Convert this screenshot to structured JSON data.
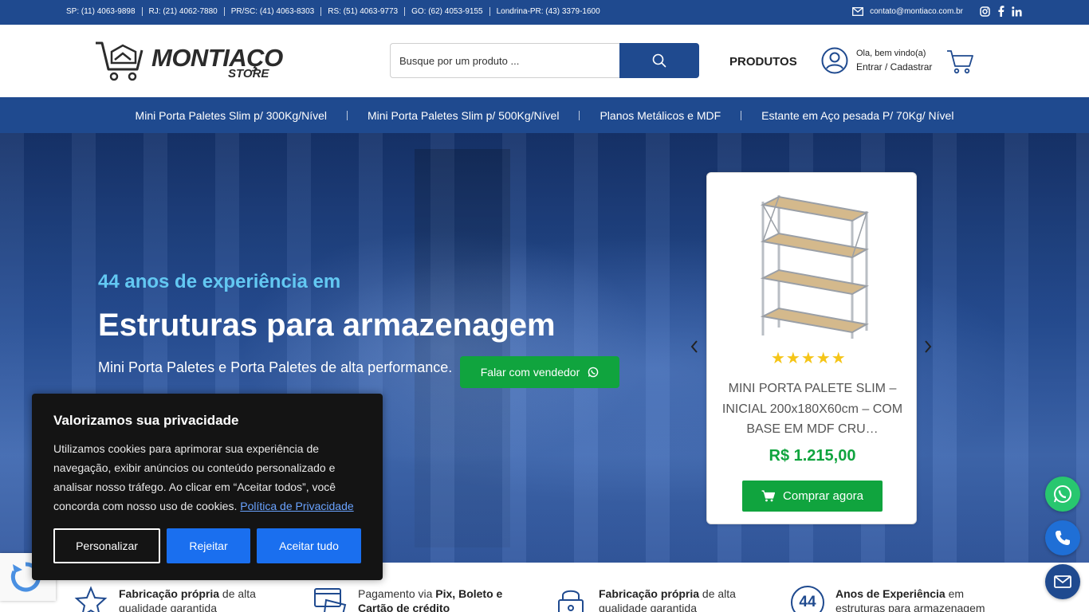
{
  "topbar": {
    "phones": [
      "SP: (11) 4063-9898",
      "RJ: (21) 4062-7880",
      "PR/SC: (41) 4063-8303",
      "RS: (51) 4063-9773",
      "GO: (62) 4053-9155",
      "Londrina-PR: (43) 3379-1600"
    ],
    "email": "contato@montiaco.com.br",
    "social_icons": [
      "instagram-icon",
      "facebook-icon",
      "linkedin-icon"
    ]
  },
  "header": {
    "logo_word": "MONTIAÇO",
    "logo_sub": "STORE",
    "search_placeholder": "Busque por um produto ...",
    "produtos_label": "PRODUTOS",
    "greeting": "Ola, bem vindo(a)",
    "login_label": "Entrar / Cadastrar"
  },
  "nav": {
    "items": [
      "Mini Porta Paletes Slim p/ 300Kg/Nível",
      "Mini Porta Paletes Slim p/ 500Kg/Nível",
      "Planos Metálicos e MDF",
      "Estante em Aço pesada P/ 70Kg/ Nível"
    ]
  },
  "hero": {
    "subtitle": "44 anos de experiência em",
    "title": "Estruturas para armazenagem",
    "description": "Mini Porta Paletes e Porta Paletes de alta performance.",
    "cta_label": "Falar com vendedor"
  },
  "product": {
    "stars": "★★★★★",
    "name": "MINI PORTA PALETE SLIM – INICIAL 200x180X60cm – COM BASE EM MDF CRU…",
    "price": "R$ 1.215,00",
    "buy_label": "Comprar agora"
  },
  "features": [
    {
      "bold": "Fabricação própria",
      "rest": " de alta qualidade garantida",
      "icon": "star-icon"
    },
    {
      "pre": "Pagamento via ",
      "bold": "Pix, Boleto e Cartão de crédito",
      "icon": "credit-card-icon"
    },
    {
      "bold": "Fabricação própria",
      "rest": " de alta qualidade garantida",
      "icon": "lock-icon"
    },
    {
      "bold": "Anos de Experiência",
      "rest": " em estruturas para armazenagem",
      "icon_text": "44",
      "icon": "44-years-icon"
    }
  ],
  "cookie": {
    "title": "Valorizamos sua privacidade",
    "body": "Utilizamos cookies para aprimorar sua experiência de navegação, exibir anúncios ou conteúdo personalizado e analisar nosso tráfego. Ao clicar em “Aceitar todos”, você concorda com nosso uso de cookies. ",
    "policy_link": "Política de Privacidade",
    "customize_label": "Personalizar",
    "reject_label": "Rejeitar",
    "accept_label": "Aceitar tudo"
  },
  "colors": {
    "brand_blue": "#1f4a8f",
    "green": "#10a43e",
    "accent_cyan": "#63c8f2",
    "cookie_button_blue": "#1a6fef"
  }
}
